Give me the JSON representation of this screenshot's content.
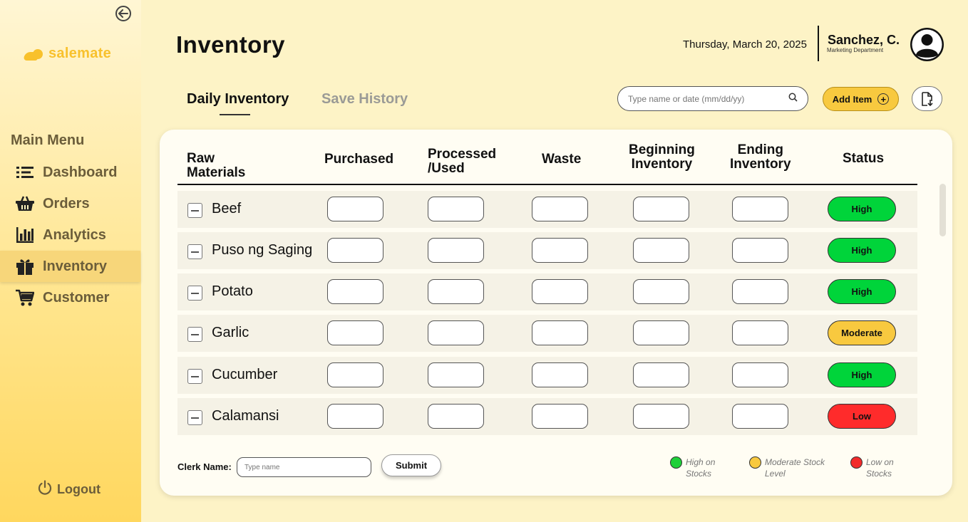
{
  "app": {
    "name": "salemate"
  },
  "sidebar": {
    "menu_heading": "Main Menu",
    "items": [
      {
        "label": "Dashboard",
        "icon": "list-icon",
        "active": false
      },
      {
        "label": "Orders",
        "icon": "basket-icon",
        "active": false
      },
      {
        "label": "Analytics",
        "icon": "bar-chart-icon",
        "active": false
      },
      {
        "label": "Inventory",
        "icon": "boxes-icon",
        "active": true
      },
      {
        "label": "Customer",
        "icon": "cart-icon",
        "active": false
      }
    ],
    "logout_label": "Logout"
  },
  "header": {
    "title": "Inventory",
    "date": "Thursday, March 20, 2025",
    "user_name": "Sanchez, C.",
    "user_department": "Marketing Department"
  },
  "tabs": [
    {
      "label": "Daily Inventory",
      "active": true
    },
    {
      "label": "Save History",
      "active": false
    }
  ],
  "search": {
    "placeholder": "Type name or date (mm/dd/yy)"
  },
  "toolbar": {
    "add_item_label": "Add Item"
  },
  "table": {
    "columns": {
      "raw_materials": [
        "Raw",
        "Materials"
      ],
      "purchased": "Purchased",
      "processed": [
        "Processed",
        "/Used"
      ],
      "waste": "Waste",
      "beginning": [
        "Beginning",
        "Inventory"
      ],
      "ending": [
        "Ending",
        "Inventory"
      ],
      "status": "Status"
    },
    "rows": [
      {
        "name": "Beef",
        "status": "High"
      },
      {
        "name": "Puso ng Saging",
        "status": "High"
      },
      {
        "name": "Potato",
        "status": "High"
      },
      {
        "name": "Garlic",
        "status": "Moderate"
      },
      {
        "name": "Cucumber",
        "status": "High"
      },
      {
        "name": "Calamansi",
        "status": "Low"
      }
    ]
  },
  "footer": {
    "clerk_label": "Clerk Name:",
    "clerk_placeholder": "Type name",
    "submit_label": "Submit",
    "legend": [
      {
        "label": "High on Stocks",
        "color": "#1fd03a"
      },
      {
        "label": "Moderate Stock Level",
        "color": "#f8c93f"
      },
      {
        "label": "Low on Stocks",
        "color": "#f22b2b"
      }
    ]
  },
  "colors": {
    "high": "#00d43a",
    "moderate": "#f8c93f",
    "low": "#ff2b2b",
    "accent": "#f8c12c"
  }
}
